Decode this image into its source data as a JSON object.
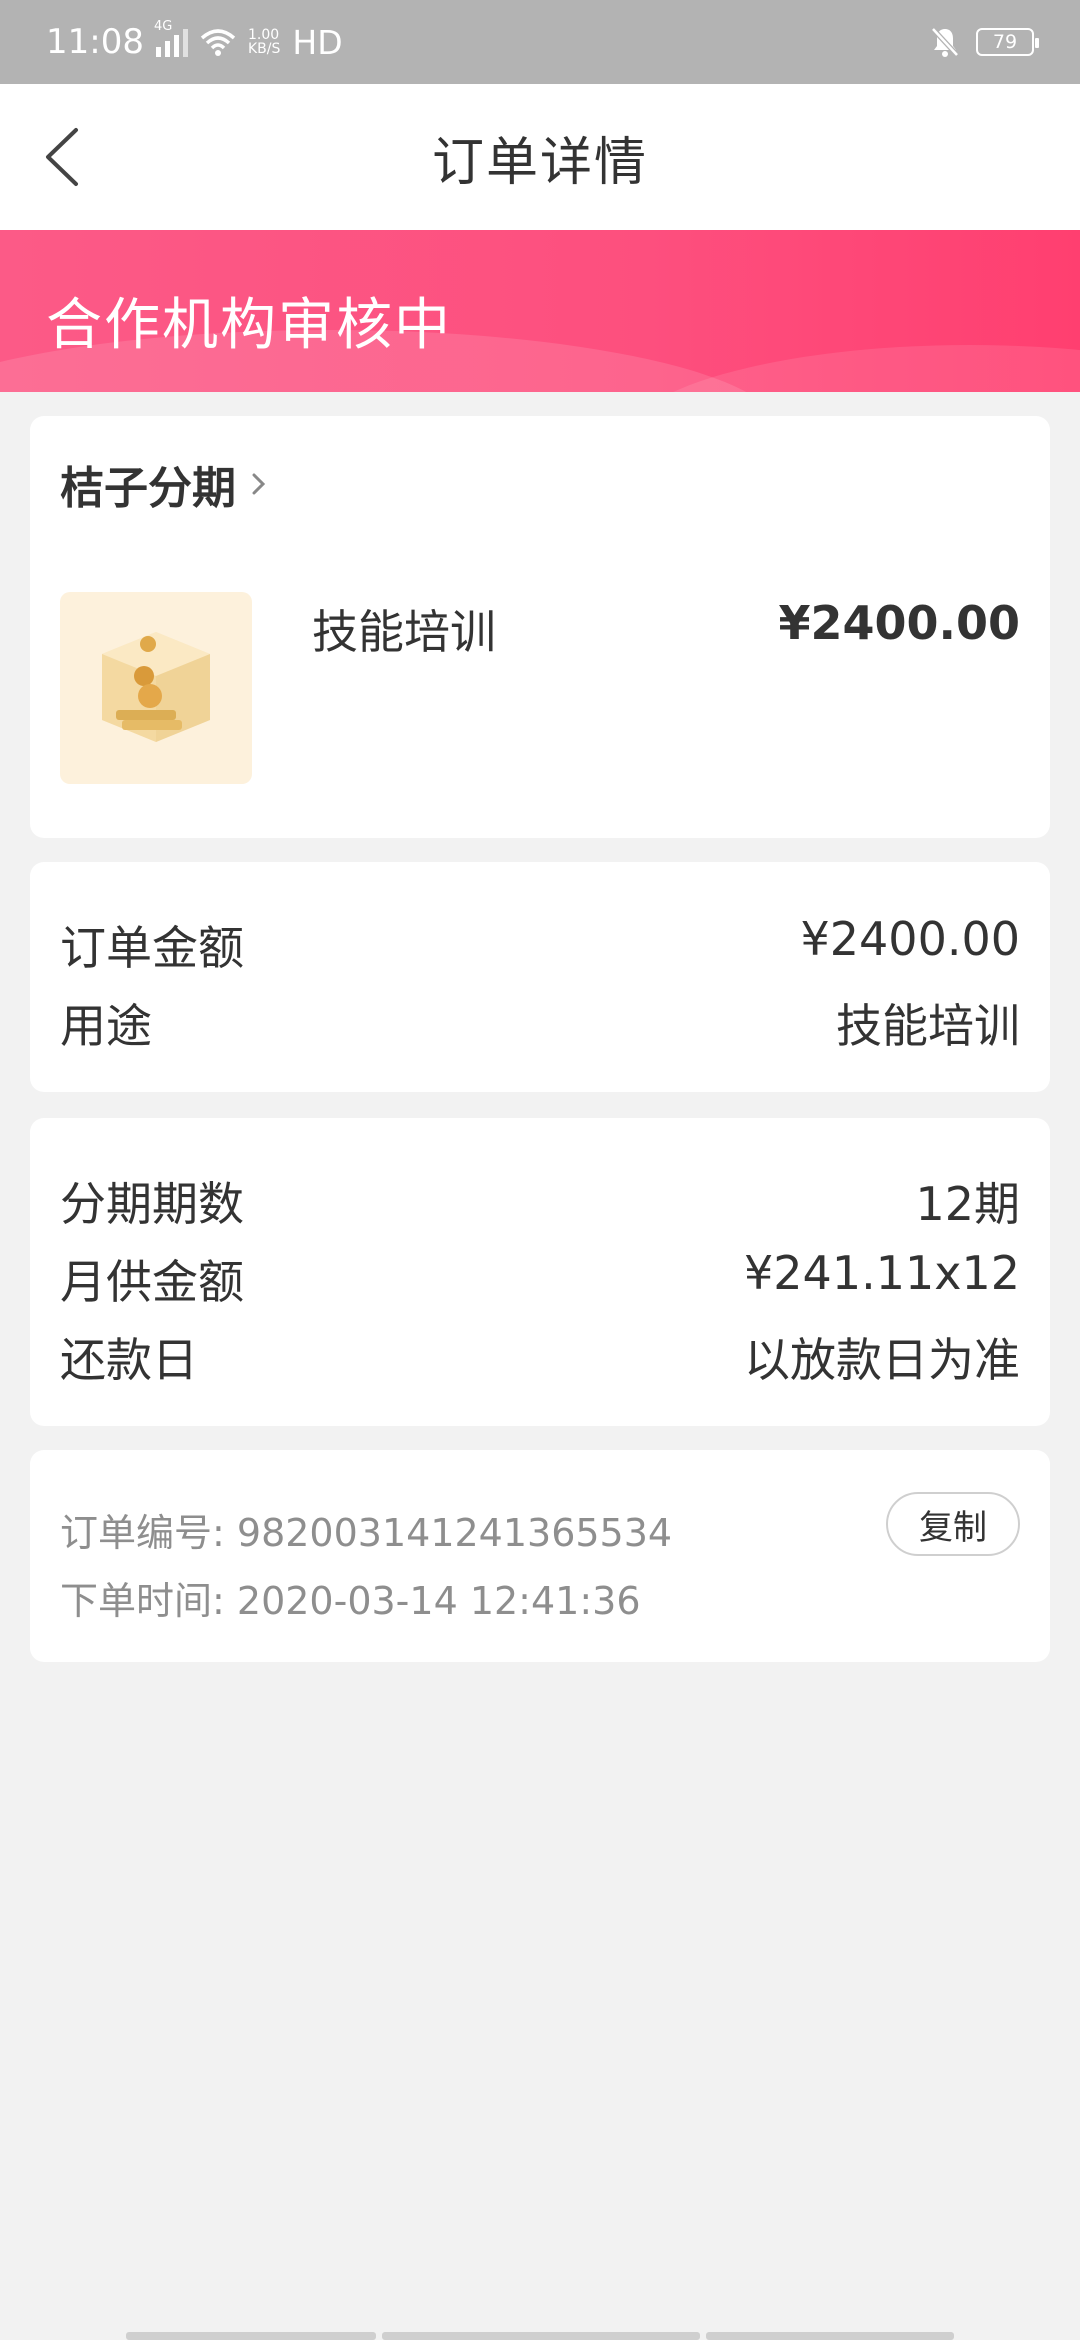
{
  "status_bar": {
    "time": "11:08",
    "network_type": "4G",
    "net_speed_value": "1.00",
    "net_speed_unit": "KB/S",
    "hd_label": "HD",
    "battery_level": "79"
  },
  "header": {
    "title": "订单详情"
  },
  "banner": {
    "status_text": "合作机构审核中"
  },
  "product_card": {
    "provider": "桔子分期",
    "product_name": "技能培训",
    "price": "¥2400.00"
  },
  "order_info": {
    "amount_label": "订单金额",
    "amount_value": "¥2400.00",
    "purpose_label": "用途",
    "purpose_value": "技能培训"
  },
  "installment_info": {
    "periods_label": "分期期数",
    "periods_value": "12期",
    "monthly_label": "月供金额",
    "monthly_value": "¥241.11x12",
    "repay_label": "还款日",
    "repay_value": "以放款日为准"
  },
  "order_meta": {
    "order_no_label": "订单编号:",
    "order_no_value": "982003141241365534",
    "order_time_label": "下单时间:",
    "order_time_value": "2020-03-14 12:41:36",
    "copy_label": "复制"
  },
  "colors": {
    "banner_start": "#fc5a87",
    "banner_end": "#ff3f70",
    "background": "#f2f2f2"
  }
}
